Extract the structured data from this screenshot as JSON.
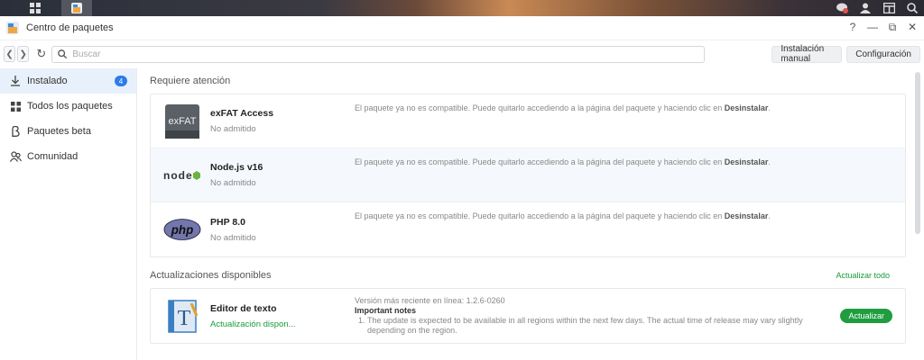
{
  "window": {
    "title": "Centro de paquetes"
  },
  "window_controls": {
    "help": "?",
    "minimize": "—",
    "restore": "⧉",
    "close": "✕"
  },
  "toolbar": {
    "search_placeholder": "Buscar",
    "manual_install": "Instalación manual",
    "settings": "Configuración"
  },
  "sidebar": {
    "items": [
      {
        "label": "Instalado",
        "icon": "download-icon",
        "badge": "4"
      },
      {
        "label": "Todos los paquetes",
        "icon": "grid-icon"
      },
      {
        "label": "Paquetes beta",
        "icon": "beta-icon"
      },
      {
        "label": "Comunidad",
        "icon": "community-icon"
      }
    ]
  },
  "attention": {
    "title": "Requiere atención",
    "message_prefix": "El paquete ya no es compatible. Puede quitarlo accediendo a la página del paquete y haciendo clic en ",
    "message_action": "Desinstalar",
    "message_suffix": ".",
    "packages": [
      {
        "name": "exFAT Access",
        "status": "No admitido",
        "icon": "exfat-icon",
        "icon_text": "exFAT"
      },
      {
        "name": "Node.js v16",
        "status": "No admitido",
        "icon": "nodejs-icon",
        "icon_text": "node"
      },
      {
        "name": "PHP 8.0",
        "status": "No admitido",
        "icon": "php-icon",
        "icon_text": "php"
      }
    ]
  },
  "updates": {
    "title": "Actualizaciones disponibles",
    "update_all": "Actualizar todo",
    "packages": [
      {
        "name": "Editor de texto",
        "status": "Actualización dispon...",
        "icon": "text-editor-icon",
        "latest_version": "Versión más reciente en línea: 1.2.6-0260",
        "notes_title": "Important notes",
        "note_1": "The update is expected to be available in all regions within the next few days. The actual time of release may vary slightly depending on the region.",
        "button": "Actualizar"
      }
    ]
  },
  "colors": {
    "accent": "#2b7de9",
    "green": "#1f9d3f"
  }
}
